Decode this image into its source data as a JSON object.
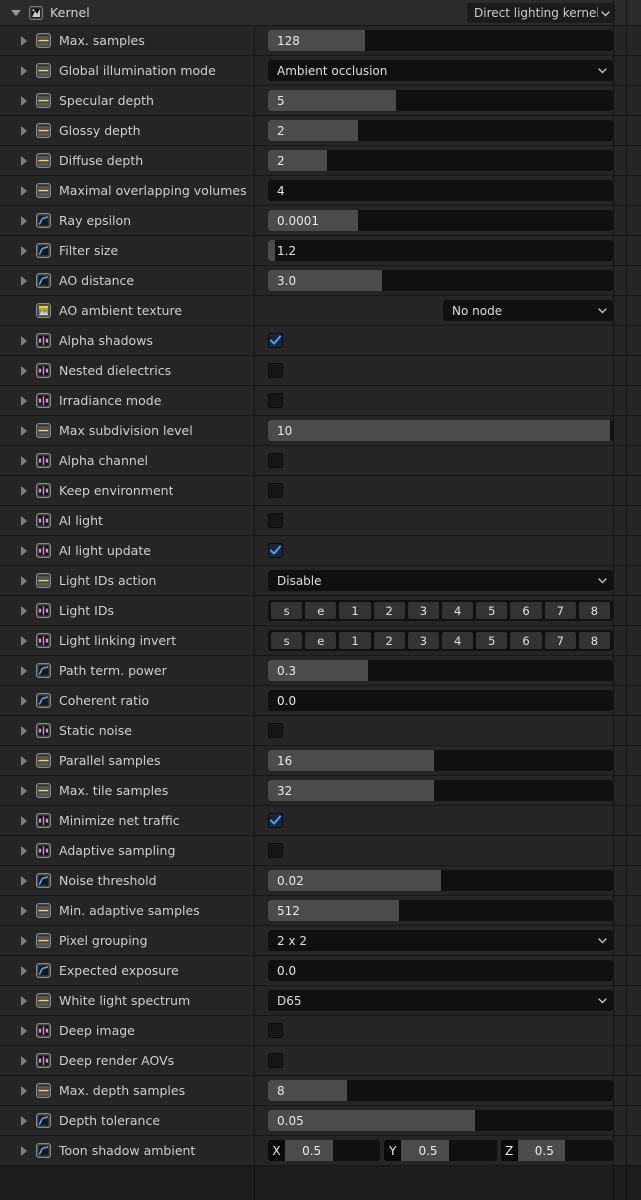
{
  "header": {
    "title": "Kernel",
    "icon": "kernel-icon",
    "expand_icon": "triangle-down-icon",
    "kernel_select": {
      "value": "Direct lighting kernel",
      "icon": "chevron-down-icon"
    }
  },
  "colors": {
    "accent_blue": "#4772b3",
    "check_blue": "#4a9eff",
    "row_bg": "#252525",
    "field_bg": "#101010",
    "slider_fill": "#4b4b4b",
    "int_icon": "#e8d86a",
    "float_icon": "#6fa8dc",
    "bool_icon": "#d88ed8",
    "tex_icon": "#8fd18f"
  },
  "rows": [
    {
      "label": "Max. samples",
      "icon": "int-property-icon",
      "type": "slider",
      "value": "128",
      "fill": 28
    },
    {
      "label": "Global illumination mode",
      "icon": "int-property-icon",
      "type": "enum",
      "value": "Ambient occlusion"
    },
    {
      "label": "Specular depth",
      "icon": "int-property-icon",
      "type": "slider",
      "value": "5",
      "fill": 37
    },
    {
      "label": "Glossy depth",
      "icon": "int-property-icon",
      "type": "slider",
      "value": "2",
      "fill": 26
    },
    {
      "label": "Diffuse depth",
      "icon": "int-property-icon",
      "type": "slider",
      "value": "2",
      "fill": 17
    },
    {
      "label": "Maximal overlapping volumes",
      "icon": "int-property-icon",
      "type": "slider",
      "value": "4",
      "fill": 0
    },
    {
      "label": "Ray epsilon",
      "icon": "float-property-icon",
      "type": "slider",
      "value": "0.0001",
      "fill": 26
    },
    {
      "label": "Filter size",
      "icon": "float-property-icon",
      "type": "slider",
      "value": "1.2",
      "fill": 2
    },
    {
      "label": "AO distance",
      "icon": "float-property-icon",
      "type": "slider",
      "value": "3.0",
      "fill": 33
    },
    {
      "label": "AO ambient texture",
      "icon": "texture-property-icon",
      "type": "node",
      "value": "No node",
      "no_triangle": true
    },
    {
      "label": "Alpha shadows",
      "icon": "bool-property-icon",
      "type": "check",
      "value": true
    },
    {
      "label": "Nested dielectrics",
      "icon": "bool-property-icon",
      "type": "check",
      "value": false
    },
    {
      "label": "Irradiance mode",
      "icon": "bool-property-icon",
      "type": "check",
      "value": false
    },
    {
      "label": "Max subdivision level",
      "icon": "int-property-icon",
      "type": "slider",
      "value": "10",
      "fill": 99
    },
    {
      "label": "Alpha channel",
      "icon": "bool-property-icon",
      "type": "check",
      "value": false
    },
    {
      "label": "Keep environment",
      "icon": "bool-property-icon",
      "type": "check",
      "value": false
    },
    {
      "label": "AI light",
      "icon": "bool-property-icon",
      "type": "check",
      "value": false
    },
    {
      "label": "AI light update",
      "icon": "bool-property-icon",
      "type": "check",
      "value": true
    },
    {
      "label": "Light IDs action",
      "icon": "int-property-icon",
      "type": "enum",
      "value": "Disable"
    },
    {
      "label": "Light IDs",
      "icon": "bool-property-icon",
      "type": "toggles",
      "value": [
        "s",
        "e",
        "1",
        "2",
        "3",
        "4",
        "5",
        "6",
        "7",
        "8"
      ]
    },
    {
      "label": "Light linking invert",
      "icon": "bool-property-icon",
      "type": "toggles",
      "value": [
        "s",
        "e",
        "1",
        "2",
        "3",
        "4",
        "5",
        "6",
        "7",
        "8"
      ]
    },
    {
      "label": "Path term. power",
      "icon": "float-property-icon",
      "type": "slider",
      "value": "0.3",
      "fill": 29
    },
    {
      "label": "Coherent ratio",
      "icon": "float-property-icon",
      "type": "slider",
      "value": "0.0",
      "fill": 0
    },
    {
      "label": "Static noise",
      "icon": "bool-property-icon",
      "type": "check",
      "value": false
    },
    {
      "label": "Parallel samples",
      "icon": "int-property-icon",
      "type": "slider",
      "value": "16",
      "fill": 48
    },
    {
      "label": "Max. tile samples",
      "icon": "int-property-icon",
      "type": "slider",
      "value": "32",
      "fill": 48
    },
    {
      "label": "Minimize net traffic",
      "icon": "bool-property-icon",
      "type": "check",
      "value": true
    },
    {
      "label": "Adaptive sampling",
      "icon": "bool-property-icon",
      "type": "check",
      "value": false
    },
    {
      "label": "Noise threshold",
      "icon": "float-property-icon",
      "type": "slider",
      "value": "0.02",
      "fill": 50
    },
    {
      "label": "Min. adaptive samples",
      "icon": "int-property-icon",
      "type": "slider",
      "value": "512",
      "fill": 38
    },
    {
      "label": "Pixel grouping",
      "icon": "int-property-icon",
      "type": "enum",
      "value": "2 x 2"
    },
    {
      "label": "Expected exposure",
      "icon": "float-property-icon",
      "type": "slider",
      "value": "0.0",
      "fill": 0
    },
    {
      "label": "White light spectrum",
      "icon": "int-property-icon",
      "type": "enum",
      "value": "D65"
    },
    {
      "label": "Deep image",
      "icon": "bool-property-icon",
      "type": "check",
      "value": false
    },
    {
      "label": "Deep render AOVs",
      "icon": "bool-property-icon",
      "type": "check",
      "value": false
    },
    {
      "label": "Max. depth samples",
      "icon": "int-property-icon",
      "type": "slider",
      "value": "8",
      "fill": 23
    },
    {
      "label": "Depth tolerance",
      "icon": "float-property-icon",
      "type": "slider",
      "value": "0.05",
      "fill": 60
    },
    {
      "label": "Toon shadow ambient",
      "icon": "float-property-icon",
      "type": "vector",
      "value": [
        {
          "axis": "X",
          "v": "0.5",
          "fill": 50
        },
        {
          "axis": "Y",
          "v": "0.5",
          "fill": 50
        },
        {
          "axis": "Z",
          "v": "0.5",
          "fill": 50
        }
      ]
    }
  ]
}
